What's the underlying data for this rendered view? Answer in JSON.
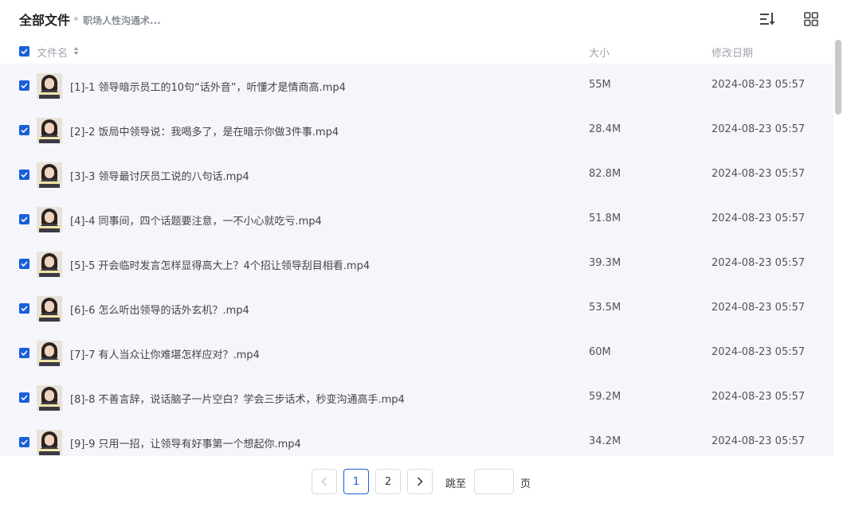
{
  "header": {
    "title": "全部文件",
    "breadcrumb": "职场人性沟通术...",
    "icons": [
      "sort-order-icon",
      "grid-view-icon"
    ]
  },
  "columns": {
    "name": "文件名",
    "size": "大小",
    "date": "修改日期"
  },
  "colors": {
    "accent": "#1a5ed8",
    "row_background": "#f4f6fb"
  },
  "files": [
    {
      "name": "[1]-1 领导暗示员工的10句“话外音”，听懂才是情商高.mp4",
      "size": "55M",
      "date": "2024-08-23 05:57",
      "checked": true
    },
    {
      "name": "[2]-2 饭局中领导说：我喝多了，是在暗示你做3件事.mp4",
      "size": "28.4M",
      "date": "2024-08-23 05:57",
      "checked": true
    },
    {
      "name": "[3]-3 领导最讨厌员工说的八句话.mp4",
      "size": "82.8M",
      "date": "2024-08-23 05:57",
      "checked": true
    },
    {
      "name": "[4]-4 同事间，四个话题要注意，一不小心就吃亏.mp4",
      "size": "51.8M",
      "date": "2024-08-23 05:57",
      "checked": true
    },
    {
      "name": "[5]-5 开会临时发言怎样显得高大上？4个招让领导刮目相看.mp4",
      "size": "39.3M",
      "date": "2024-08-23 05:57",
      "checked": true
    },
    {
      "name": "[6]-6 怎么听出领导的话外玄机？.mp4",
      "size": "53.5M",
      "date": "2024-08-23 05:57",
      "checked": true
    },
    {
      "name": "[7]-7 有人当众让你难堪怎样应对？.mp4",
      "size": "60M",
      "date": "2024-08-23 05:57",
      "checked": true
    },
    {
      "name": "[8]-8 不善言辞，说话脑子一片空白？学会三步话术，秒变沟通高手.mp4",
      "size": "59.2M",
      "date": "2024-08-23 05:57",
      "checked": true
    },
    {
      "name": "[9]-9 只用一招，让领导有好事第一个想起你.mp4",
      "size": "34.2M",
      "date": "2024-08-23 05:57",
      "checked": true
    }
  ],
  "pagination": {
    "pages": [
      "1",
      "2"
    ],
    "current": "1",
    "jump_label": "跳至",
    "jump_value": "",
    "page_unit": "页"
  }
}
